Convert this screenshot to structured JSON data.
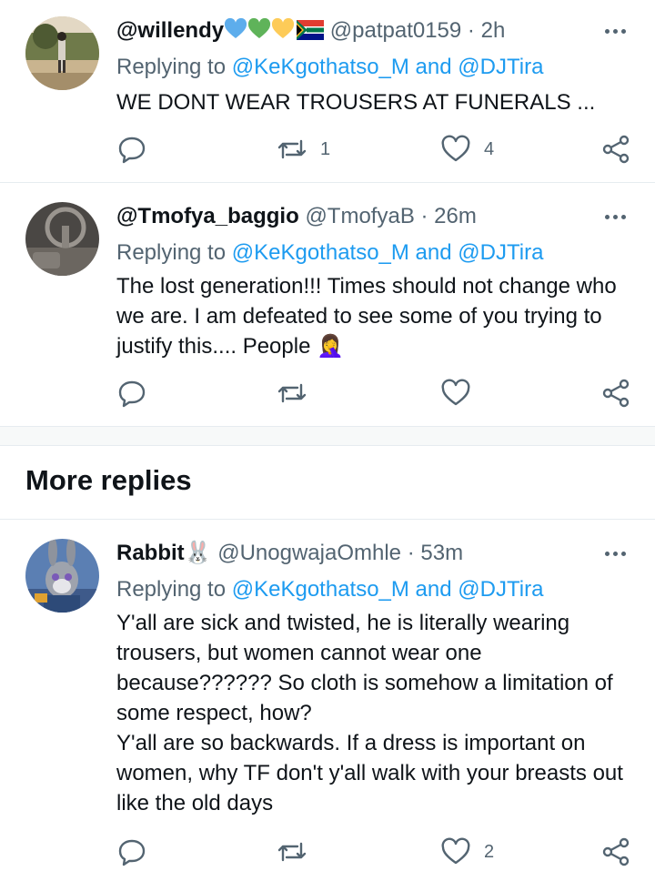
{
  "tweets": [
    {
      "name": "@willendy",
      "handle": "@patpat0159",
      "sep": "·",
      "time": "2h",
      "reply_prefix": "Replying to ",
      "mention1": "@KeKgothatso_M",
      "reply_and": " and ",
      "mention2": "@DJTira",
      "text": "WE DONT WEAR TROUSERS AT FUNERALS ...",
      "retweets": "1",
      "likes": "4",
      "name_emojis": [
        "blue-heart",
        "green-heart",
        "yellow-heart",
        "south-africa-flag"
      ]
    },
    {
      "name": "@Tmofya_baggio",
      "handle": "@TmofyaB",
      "sep": "·",
      "time": "26m",
      "reply_prefix": "Replying to ",
      "mention1": "@KeKgothatso_M",
      "reply_and": " and ",
      "mention2": "@DJTira",
      "text": "The lost generation!!! Times should not change who we are. I am defeated to see some of you trying to justify this.... People",
      "text_emoji": "🤦‍♀️",
      "retweets": "",
      "likes": ""
    },
    {
      "name": "Rabbit",
      "name_emoji": "🐰",
      "handle": "@UnogwajaOmhle",
      "sep": "·",
      "time": "53m",
      "reply_prefix": "Replying to ",
      "mention1": "@KeKgothatso_M",
      "reply_and": " and ",
      "mention2": "@DJTira",
      "text_lines": [
        "Y'all are sick and twisted, he is literally wearing trousers, but women cannot wear one because?????? So cloth is somehow a limitation of some respect, how?",
        "Y'all are so backwards. If a dress is important on women, why TF don't y'all walk with your breasts out like the old days"
      ],
      "retweets": "",
      "likes": "2"
    }
  ],
  "section": {
    "more_replies": "More replies"
  },
  "colors": {
    "accent": "#1d9bf0",
    "muted": "#536471",
    "text": "#0f1419"
  },
  "icons": [
    "reply-icon",
    "retweet-icon",
    "like-icon",
    "share-icon",
    "more-icon"
  ]
}
